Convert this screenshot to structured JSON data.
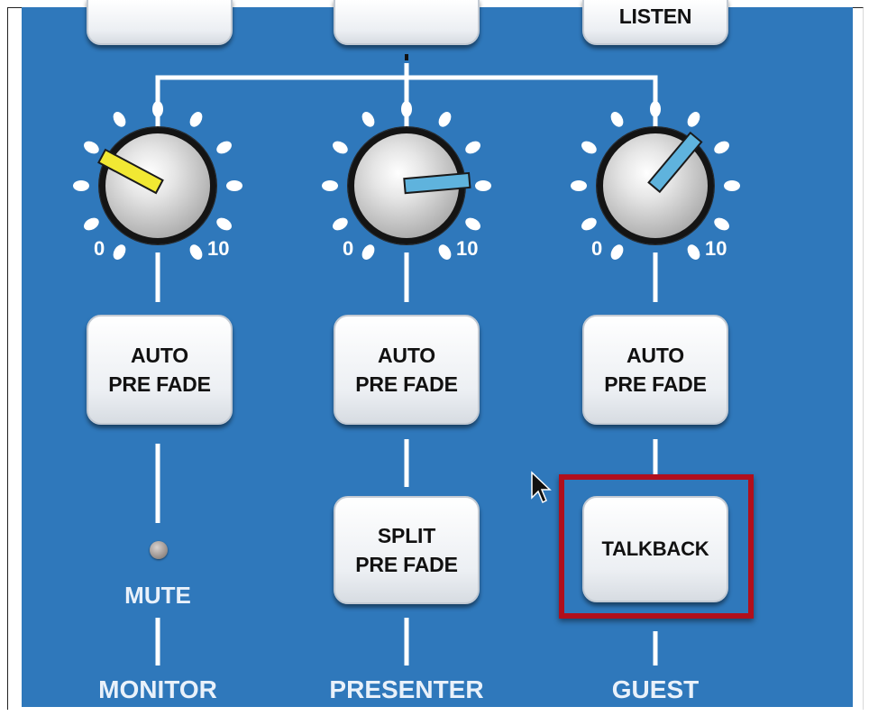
{
  "top_buttons": {
    "left_label": "",
    "middle_label": "",
    "right_label": "LISTEN"
  },
  "knob_scale": {
    "min_label": "0",
    "max_label": "10"
  },
  "channels": [
    {
      "name": "MONITOR",
      "knob_color": "#f1e833",
      "auto_pre_fade": [
        "AUTO",
        "PRE FADE"
      ],
      "mute_label": "MUTE"
    },
    {
      "name": "PRESENTER",
      "knob_color": "#5fb3dd",
      "auto_pre_fade": [
        "AUTO",
        "PRE FADE"
      ],
      "split_pre_fade": [
        "SPLIT",
        "PRE FADE"
      ]
    },
    {
      "name": "GUEST",
      "knob_color": "#5fb3dd",
      "auto_pre_fade": [
        "AUTO",
        "PRE FADE"
      ],
      "talkback_label": "TALKBACK"
    }
  ],
  "colors": {
    "panel": "#2f78bb",
    "highlight": "#b10f1c",
    "line": "#ffffff"
  }
}
